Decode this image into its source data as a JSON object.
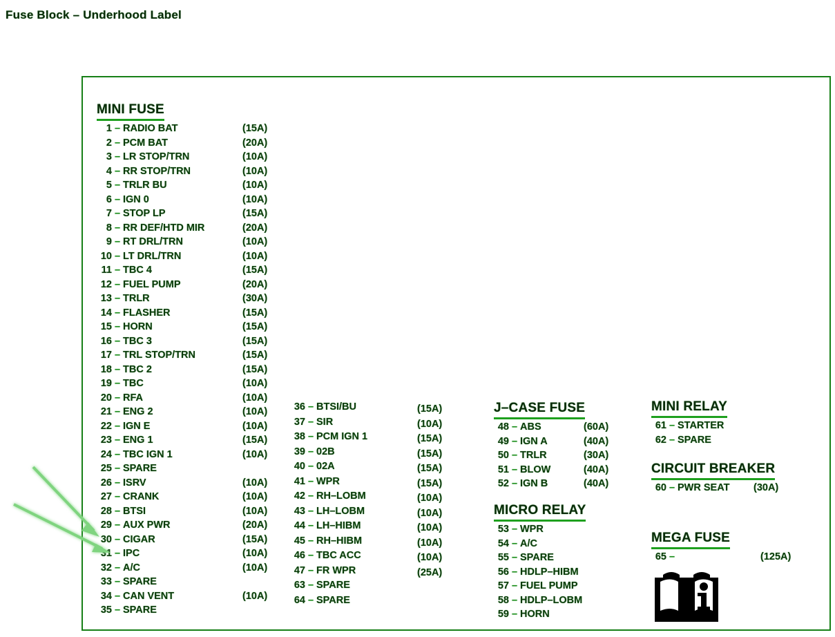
{
  "page": {
    "title": "Fuse Block – Underhood Label"
  },
  "colors": {
    "frame": "#167f16",
    "heading": "#0b2a0b",
    "body_text": "#0d3a0d",
    "underline": "#1ea01e",
    "arrow": "#7fd47f",
    "icon": "#000000"
  },
  "sections": {
    "mini_fuse": {
      "heading": "MINI FUSE",
      "rows": [
        {
          "num": "1",
          "dash": "–",
          "label": "RADIO BAT",
          "amp": "(15A)"
        },
        {
          "num": "2",
          "dash": "–",
          "label": "PCM BAT",
          "amp": "(20A)"
        },
        {
          "num": "3",
          "dash": "–",
          "label": "LR STOP/TRN",
          "amp": "(10A)"
        },
        {
          "num": "4",
          "dash": "–",
          "label": "RR STOP/TRN",
          "amp": "(10A)"
        },
        {
          "num": "5",
          "dash": "–",
          "label": "TRLR BU",
          "amp": "(10A)"
        },
        {
          "num": "6",
          "dash": "–",
          "label": "IGN 0",
          "amp": "(10A)"
        },
        {
          "num": "7",
          "dash": "–",
          "label": "STOP LP",
          "amp": "(15A)"
        },
        {
          "num": "8",
          "dash": "–",
          "label": "RR DEF/HTD MIR",
          "amp": "(20A)"
        },
        {
          "num": "9",
          "dash": "–",
          "label": "RT DRL/TRN",
          "amp": "(10A)"
        },
        {
          "num": "10",
          "dash": "–",
          "label": "LT DRL/TRN",
          "amp": "(10A)"
        },
        {
          "num": "11",
          "dash": "–",
          "label": "TBC 4",
          "amp": "(15A)"
        },
        {
          "num": "12",
          "dash": "–",
          "label": "FUEL PUMP",
          "amp": "(20A)"
        },
        {
          "num": "13",
          "dash": "–",
          "label": "TRLR",
          "amp": "(30A)"
        },
        {
          "num": "14",
          "dash": "–",
          "label": "FLASHER",
          "amp": "(15A)"
        },
        {
          "num": "15",
          "dash": "–",
          "label": "HORN",
          "amp": "(15A)"
        },
        {
          "num": "16",
          "dash": "–",
          "label": "TBC 3",
          "amp": "(15A)"
        },
        {
          "num": "17",
          "dash": "–",
          "label": "TRL STOP/TRN",
          "amp": "(15A)"
        },
        {
          "num": "18",
          "dash": "–",
          "label": "TBC 2",
          "amp": "(15A)"
        },
        {
          "num": "19",
          "dash": "–",
          "label": "TBC",
          "amp": "(10A)"
        },
        {
          "num": "20",
          "dash": "–",
          "label": "RFA",
          "amp": "(10A)"
        },
        {
          "num": "21",
          "dash": "–",
          "label": "ENG 2",
          "amp": "(10A)"
        },
        {
          "num": "22",
          "dash": "–",
          "label": "IGN E",
          "amp": "(10A)"
        },
        {
          "num": "23",
          "dash": "–",
          "label": "ENG 1",
          "amp": "(15A)"
        },
        {
          "num": "24",
          "dash": "–",
          "label": "TBC IGN 1",
          "amp": "(10A)"
        },
        {
          "num": "25",
          "dash": "–",
          "label": "SPARE",
          "amp": ""
        },
        {
          "num": "26",
          "dash": "–",
          "label": "ISRV",
          "amp": "(10A)"
        },
        {
          "num": "27",
          "dash": "–",
          "label": "CRANK",
          "amp": "(10A)"
        },
        {
          "num": "28",
          "dash": "–",
          "label": "BTSI",
          "amp": "(10A)"
        },
        {
          "num": "29",
          "dash": "–",
          "label": "AUX PWR",
          "amp": "(20A)"
        },
        {
          "num": "30",
          "dash": "–",
          "label": "CIGAR",
          "amp": "(15A)"
        },
        {
          "num": "31",
          "dash": "–",
          "label": "IPC",
          "amp": "(10A)"
        },
        {
          "num": "32",
          "dash": "–",
          "label": "A/C",
          "amp": "(10A)"
        },
        {
          "num": "33",
          "dash": "–",
          "label": "SPARE",
          "amp": ""
        },
        {
          "num": "34",
          "dash": "–",
          "label": "CAN VENT",
          "amp": "(10A)"
        },
        {
          "num": "35",
          "dash": "–",
          "label": "SPARE",
          "amp": ""
        }
      ]
    },
    "mini_fuse_cont": {
      "heading": "",
      "rows": [
        {
          "num": "36",
          "dash": "–",
          "label": "BTSI/BU",
          "amp": "(15A)"
        },
        {
          "num": "37",
          "dash": "–",
          "label": "SIR",
          "amp": "(10A)"
        },
        {
          "num": "38",
          "dash": "–",
          "label": "PCM IGN 1",
          "amp": "(15A)"
        },
        {
          "num": "39",
          "dash": "–",
          "label": "02B",
          "amp": "(15A)"
        },
        {
          "num": "40",
          "dash": "–",
          "label": "02A",
          "amp": "(15A)"
        },
        {
          "num": "41",
          "dash": "–",
          "label": "WPR",
          "amp": "(15A)"
        },
        {
          "num": "42",
          "dash": "–",
          "label": "RH–LOBM",
          "amp": "(10A)"
        },
        {
          "num": "43",
          "dash": "–",
          "label": "LH–LOBM",
          "amp": "(10A)"
        },
        {
          "num": "44",
          "dash": "–",
          "label": "LH–HIBM",
          "amp": "(10A)"
        },
        {
          "num": "45",
          "dash": "–",
          "label": "RH–HIBM",
          "amp": "(10A)"
        },
        {
          "num": "46",
          "dash": "–",
          "label": "TBC ACC",
          "amp": "(10A)"
        },
        {
          "num": "47",
          "dash": "–",
          "label": "FR WPR",
          "amp": "(25A)"
        },
        {
          "num": "63",
          "dash": "–",
          "label": "SPARE",
          "amp": ""
        },
        {
          "num": "64",
          "dash": "–",
          "label": "SPARE",
          "amp": ""
        }
      ]
    },
    "jcase_fuse": {
      "heading": "J–CASE FUSE",
      "rows": [
        {
          "num": "48",
          "dash": "–",
          "label": "ABS",
          "amp": "(60A)"
        },
        {
          "num": "49",
          "dash": "–",
          "label": "IGN A",
          "amp": "(40A)"
        },
        {
          "num": "50",
          "dash": "–",
          "label": "TRLR",
          "amp": "(30A)"
        },
        {
          "num": "51",
          "dash": "–",
          "label": "BLOW",
          "amp": "(40A)"
        },
        {
          "num": "52",
          "dash": "–",
          "label": "IGN B",
          "amp": "(40A)"
        }
      ]
    },
    "micro_relay": {
      "heading": "MICRO RELAY",
      "rows": [
        {
          "num": "53",
          "dash": "–",
          "label": "WPR",
          "amp": ""
        },
        {
          "num": "54",
          "dash": "–",
          "label": "A/C",
          "amp": ""
        },
        {
          "num": "55",
          "dash": "–",
          "label": "SPARE",
          "amp": ""
        },
        {
          "num": "56",
          "dash": "–",
          "label": "HDLP–HIBM",
          "amp": ""
        },
        {
          "num": "57",
          "dash": "–",
          "label": "FUEL PUMP",
          "amp": ""
        },
        {
          "num": "58",
          "dash": "–",
          "label": "HDLP–LOBM",
          "amp": ""
        },
        {
          "num": "59",
          "dash": "–",
          "label": "HORN",
          "amp": ""
        }
      ]
    },
    "mini_relay": {
      "heading": "MINI RELAY",
      "rows": [
        {
          "num": "61",
          "dash": "–",
          "label": "STARTER",
          "amp": ""
        },
        {
          "num": "62",
          "dash": "–",
          "label": "SPARE",
          "amp": ""
        }
      ]
    },
    "circuit_breaker": {
      "heading": "CIRCUIT BREAKER",
      "rows": [
        {
          "num": "60",
          "dash": "–",
          "label": "PWR SEAT",
          "amp": "(30A)"
        }
      ]
    },
    "mega_fuse": {
      "heading": "MEGA FUSE",
      "rows": [
        {
          "num": "65",
          "dash": "–",
          "label": "",
          "amp": "(125A)"
        }
      ]
    }
  },
  "annotations": {
    "arrows": [
      {
        "name": "arrow-to-fuse-29",
        "target": "29 – AUX PWR"
      },
      {
        "name": "arrow-to-fuse-30",
        "target": "30 – CIGAR"
      }
    ]
  },
  "manual_icon": {
    "name": "open-manual-info-icon",
    "letter": "i"
  }
}
